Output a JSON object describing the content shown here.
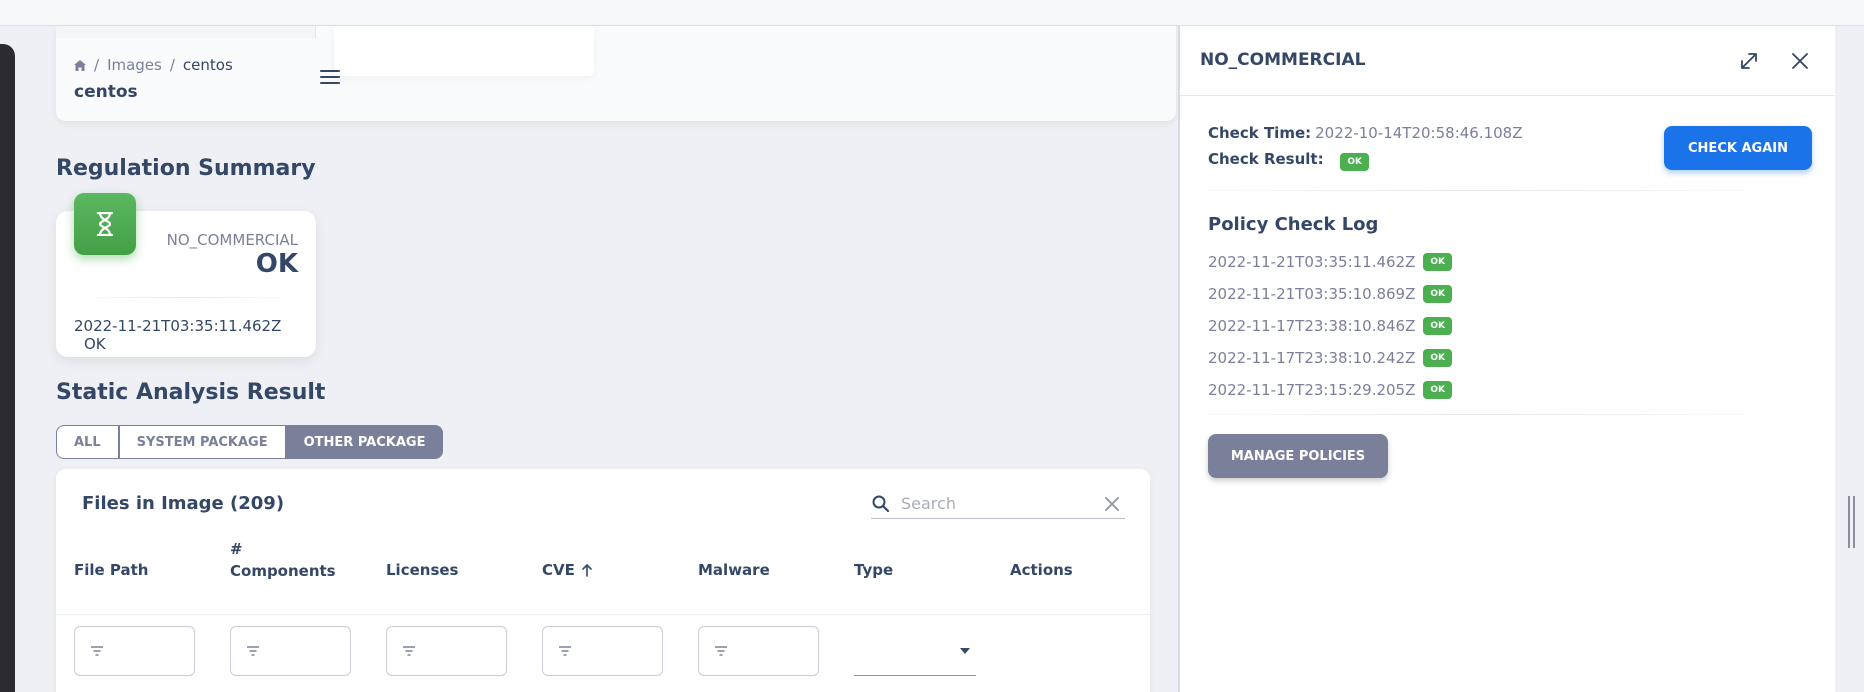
{
  "breadcrumb": {
    "items": [
      "Images",
      "centos"
    ]
  },
  "page_title": "centos",
  "regulation": {
    "section_title": "Regulation Summary",
    "label": "NO_COMMERCIAL",
    "value": "OK",
    "last_time": "2022-11-21T03:35:11.462Z",
    "last_result": "OK"
  },
  "static_analysis": {
    "section_title": "Static Analysis Result",
    "filters": [
      "ALL",
      "SYSTEM PACKAGE",
      "OTHER PACKAGE"
    ],
    "active_filter": "OTHER PACKAGE"
  },
  "files": {
    "title": "Files in Image (209)",
    "search_placeholder": "Search",
    "columns": {
      "file_path": "File Path",
      "components_1": "#",
      "components_2": "Components",
      "licenses": "Licenses",
      "cve": "CVE",
      "malware": "Malware",
      "type": "Type",
      "actions": "Actions"
    },
    "sort": {
      "column": "CVE",
      "direction": "ascending"
    }
  },
  "drawer": {
    "title": "NO_COMMERCIAL",
    "check_time_label": "Check Time:",
    "check_time": "2022-10-14T20:58:46.108Z",
    "check_result_label": "Check Result:",
    "check_result": "OK",
    "check_again": "CHECK AGAIN",
    "log_title": "Policy Check Log",
    "logs": [
      {
        "time": "2022-11-21T03:35:11.462Z",
        "status": "OK"
      },
      {
        "time": "2022-11-21T03:35:10.869Z",
        "status": "OK"
      },
      {
        "time": "2022-11-17T23:38:10.846Z",
        "status": "OK"
      },
      {
        "time": "2022-11-17T23:38:10.242Z",
        "status": "OK"
      },
      {
        "time": "2022-11-17T23:15:29.205Z",
        "status": "OK"
      }
    ],
    "manage_policies": "MANAGE POLICIES"
  },
  "colors": {
    "primary_text": "#344767",
    "muted_text": "#7b809a",
    "success": "#4caf50",
    "info": "#1a73e8",
    "secondary": "#7b809a"
  },
  "icons": [
    "home-icon",
    "menu-icon",
    "hourglass-icon",
    "search-icon",
    "clear-icon",
    "filter-icon",
    "sort-up-icon",
    "dropdown-caret-icon",
    "expand-icon",
    "close-icon"
  ]
}
